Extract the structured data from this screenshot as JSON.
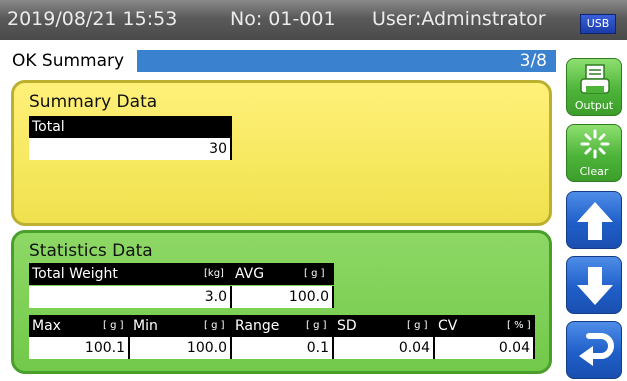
{
  "header": {
    "datetime": "2019/08/21 15:53",
    "number": "No: 01-001",
    "user": "User:Adminstrator",
    "usb_label": "USB"
  },
  "page": {
    "title": "OK Summary",
    "indicator": "3/8"
  },
  "summary": {
    "title": "Summary Data",
    "total_label": "Total",
    "total_value": "30"
  },
  "statistics": {
    "title": "Statistics Data",
    "row1": [
      {
        "label": "Total Weight",
        "unit": "[kg]",
        "value": "3.0"
      },
      {
        "label": "AVG",
        "unit": "[ g ]",
        "value": "100.0"
      }
    ],
    "row2": [
      {
        "label": "Max",
        "unit": "[ g ]",
        "value": "100.1"
      },
      {
        "label": "Min",
        "unit": "[ g ]",
        "value": "100.0"
      },
      {
        "label": "Range",
        "unit": "[ g ]",
        "value": "0.1"
      },
      {
        "label": "SD",
        "unit": "[ g ]",
        "value": "0.04"
      },
      {
        "label": "CV",
        "unit": "[ % ]",
        "value": "0.04"
      }
    ]
  },
  "side_buttons": {
    "output_label": "Output",
    "clear_label": "Clear"
  },
  "colors": {
    "header": "#5a5a5a",
    "title_bar": "#3a82d0",
    "summary_panel": "#f6e85e",
    "stats_panel": "#72c94a",
    "green_button": "#4db43a",
    "blue_button": "#1f5fc9"
  },
  "icons": {
    "output": "printer-icon",
    "clear": "burst-icon",
    "up": "arrow-up-icon",
    "down": "arrow-down-icon",
    "back": "return-arrow-icon"
  }
}
